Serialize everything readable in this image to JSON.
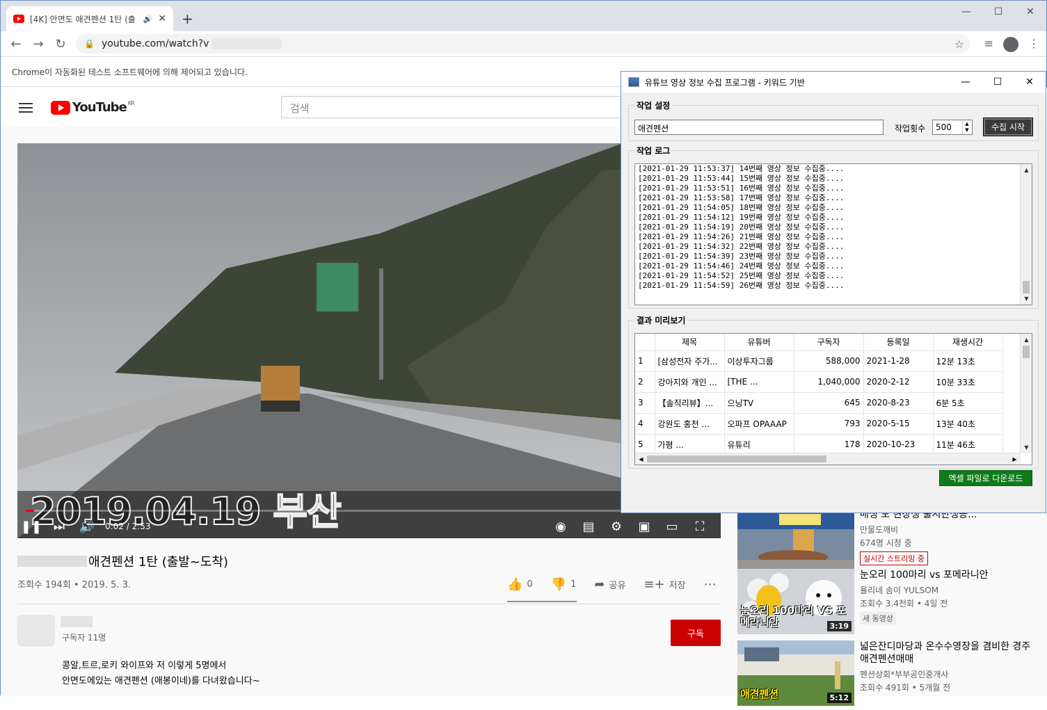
{
  "browser": {
    "tab_title": "[4K] 안면도 애견펜션 1탄 (출",
    "url": "youtube.com/watch?v",
    "infobar_text": "Chrome이 자동화된 테스트 소프트웨어에 의해 제어되고 있습니다."
  },
  "youtube": {
    "logo_text": "YouTube",
    "logo_region": "KR",
    "search_placeholder": "검색",
    "video": {
      "overlay_text": "2019.04.19 부산",
      "time": "0:02 / 2:53",
      "progress_fraction": 0.012,
      "title": "애견펜션 1탄 (출발~도착)",
      "meta": "조회수 194회 • 2019. 5. 3.",
      "likes": "0",
      "dislikes": "1",
      "share_label": "공유",
      "save_label": "저장"
    },
    "channel": {
      "subs": "구독자 11명",
      "subscribe_label": "구독"
    },
    "description": [
      "콩알,트르,로키 와이프와 저 이렇게 5명에서",
      "안면도에있는 애견펜션 (애봉이네)를 다녀왔습니다~"
    ],
    "recommendations": [
      {
        "title": "매생 포 현장생 출시반생증...",
        "channel": "만물도깨비",
        "meta": "674명 시청 중",
        "badge": "실시간 스트리밍 중",
        "duration": ""
      },
      {
        "title": "눈오리 100마리 vs 포메라니안",
        "channel": "율리네 솜이 YULSOM",
        "meta": "조회수 3.4천회 • 4일 전",
        "badge": "새 동영상",
        "duration": "3:19",
        "thumb_caption": "눈오리 100마리 VS 포메라니안"
      },
      {
        "title": "넓은잔디마당과 온수수영장을 겸비한 경주 애견펜션매매",
        "channel": "펜션상회*부부공인중개사",
        "meta": "조회수 491회 • 5개월 전",
        "badge": "",
        "duration": "5:12",
        "thumb_caption": "애견펜션"
      }
    ]
  },
  "dialog": {
    "title": "유튜브 영상 정보 수집 프로그램 - 키워드 기반",
    "settings_label": "작업 설정",
    "keyword": "애견펜션",
    "count_label": "작업횟수",
    "count_value": "500",
    "start_label": "수집 시작",
    "log_label": "작업 로그",
    "log_lines": [
      "[2021-01-29 11:53:37] 14번째 영상 정보 수집중....",
      "[2021-01-29 11:53:44] 15번째 영상 정보 수집중....",
      "[2021-01-29 11:53:51] 16번째 영상 정보 수집중....",
      "[2021-01-29 11:53:58] 17번째 영상 정보 수집중....",
      "[2021-01-29 11:54:05] 18번째 영상 정보 수집중....",
      "[2021-01-29 11:54:12] 19번째 영상 정보 수집중....",
      "[2021-01-29 11:54:19] 20번째 영상 정보 수집중....",
      "[2021-01-29 11:54:26] 21번째 영상 정보 수집중....",
      "[2021-01-29 11:54:32] 22번째 영상 정보 수집중....",
      "[2021-01-29 11:54:39] 23번째 영상 정보 수집중....",
      "[2021-01-29 11:54:46] 24번째 영상 정보 수집중....",
      "[2021-01-29 11:54:52] 25번째 영상 정보 수집중....",
      "[2021-01-29 11:54:59] 26번째 영상 정보 수집중...."
    ],
    "preview_label": "결과 미리보기",
    "columns": [
      "",
      "제목",
      "유튜버",
      "구독자",
      "등록일",
      "재생시간"
    ],
    "rows": [
      [
        "1",
        "[삼성전자 주가...",
        "이상투자그룹",
        "588,000",
        "2021-1-28",
        "12분 13초"
      ],
      [
        "2",
        "강아지와 개인 ...",
        "[THE ...",
        "1,040,000",
        "2020-2-12",
        "10분 33초"
      ],
      [
        "3",
        "【솔직리뷰】...",
        "으닝TV",
        "645",
        "2020-8-23",
        "6분 5초"
      ],
      [
        "4",
        "강원도 홍천 ...",
        "오파프 OPAAAP",
        "793",
        "2020-5-15",
        "13분 40초"
      ],
      [
        "5",
        "가평 ...",
        "유튜리",
        "178",
        "2020-10-23",
        "11분 46초"
      ]
    ],
    "excel_label": "엑셀 파일로 다운로드"
  }
}
